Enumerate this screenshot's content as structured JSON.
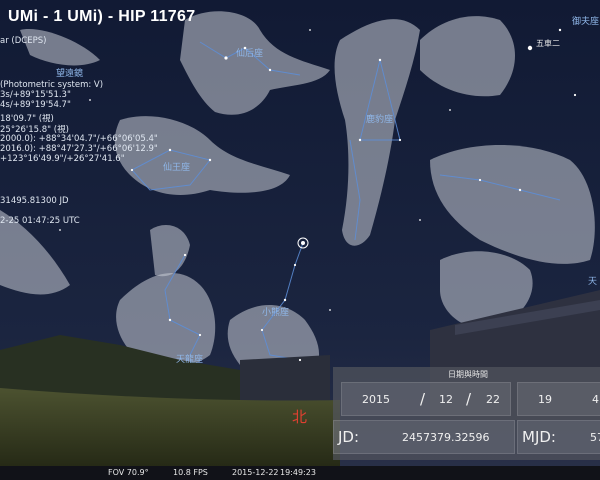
{
  "object": {
    "title": "UMi - 1 UMi) - HIP 11767",
    "info_lines": [
      "ar (DCEPS)",
      "",
      "(Photometric system: V)",
      "3s/+89°15'51.3\"",
      "4s/+89°19'54.7\"",
      "18'09.7\" (視)",
      "25°26'15.8\" (視)",
      "2000.0): +88°34'04.7\"/+66°06'05.4\"",
      "2016.0): +88°47'27.3\"/+66°06'12.9\"",
      "+123°16'49.9\"/+26°27'41.6\"",
      "",
      "31495.81300 JD",
      "",
      "2-25 01:47:25 UTC"
    ]
  },
  "constellations": {
    "cepheus": "仙王座",
    "cassiopeia": "仙后座",
    "camelopardalis": "鹿豹座",
    "ursa_minor": "小熊座",
    "draco": "天龍座",
    "lynx": "天",
    "telescope_label": "望遠鏡",
    "right_top": "御夫座"
  },
  "stars": {
    "wuche": "五車二"
  },
  "cardinal": {
    "north": "北"
  },
  "datetime_panel": {
    "title": "日期與時間",
    "year": "2015",
    "month": "12",
    "day": "22",
    "hour": "19",
    "minute": "4",
    "sep": "/",
    "jd_label": "JD:",
    "jd_value": "2457379.32596",
    "mjd_label": "MJD:",
    "mjd_value": "57"
  },
  "status": {
    "fov": "FOV 70.9°",
    "fps": "10.8 FPS",
    "date": "2015-12-22",
    "time": "19:49:23"
  },
  "colors": {
    "constellation_line": "#5d8ed8",
    "label": "#8fb6e8",
    "cardinal": "#e04030",
    "ground": "#3a3f24"
  }
}
